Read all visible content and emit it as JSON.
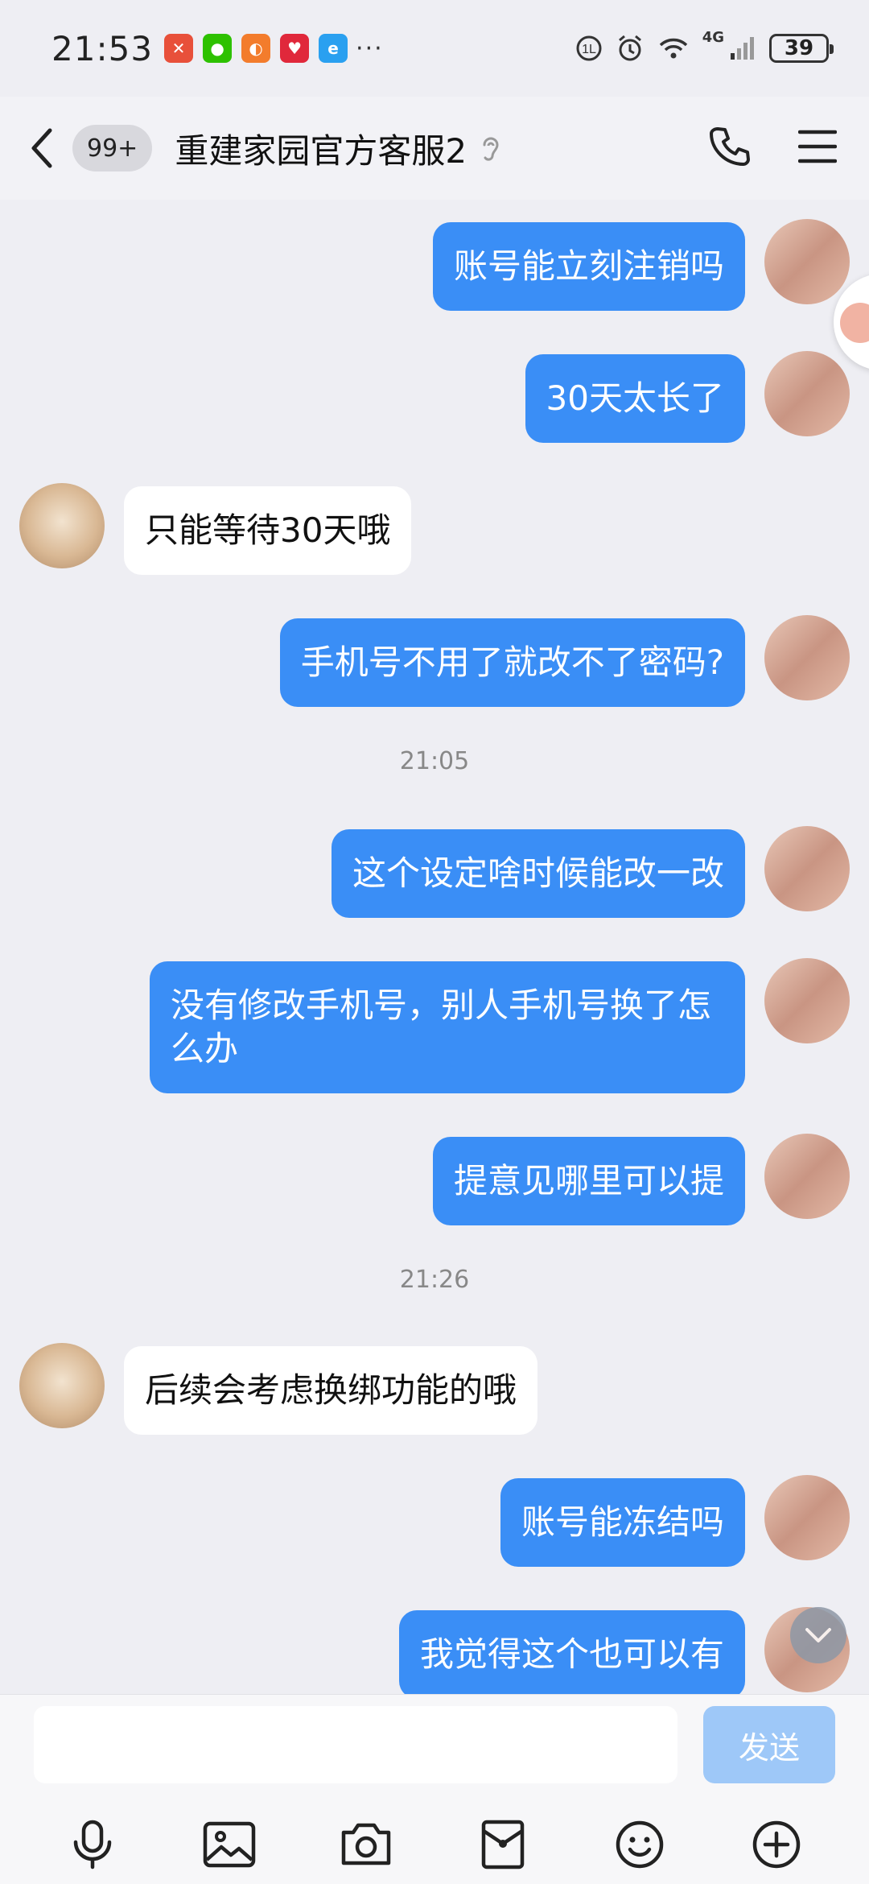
{
  "status_bar": {
    "time": "21:53",
    "network": "4G",
    "battery": "39"
  },
  "header": {
    "unread_badge": "99+",
    "title": "重建家园官方客服2"
  },
  "messages": [
    {
      "sender": "me",
      "text": "账号能立刻注销吗"
    },
    {
      "sender": "me",
      "text": "30天太长了"
    },
    {
      "sender": "bot",
      "text": "只能等待30天哦"
    },
    {
      "sender": "me",
      "text": "手机号不用了就改不了密码?"
    },
    {
      "type": "time",
      "text": "21:05"
    },
    {
      "sender": "me",
      "text": "这个设定啥时候能改一改"
    },
    {
      "sender": "me",
      "text": "没有修改手机号，别人手机号换了怎么办"
    },
    {
      "sender": "me",
      "text": "提意见哪里可以提"
    },
    {
      "type": "time",
      "text": "21:26"
    },
    {
      "sender": "bot",
      "text": "后续会考虑换绑功能的哦"
    },
    {
      "sender": "me",
      "text": "账号能冻结吗"
    },
    {
      "sender": "me",
      "text": "我觉得这个也可以有"
    }
  ],
  "composer": {
    "placeholder": "",
    "send_label": "发送"
  },
  "colors": {
    "my_bubble": "#3a8ef6",
    "bot_bubble": "#ffffff",
    "background": "#eeeef3",
    "send_disabled": "#9ec8f8"
  },
  "toolbar": {
    "items": [
      "microphone-icon",
      "image-icon",
      "camera-icon",
      "red-packet-icon",
      "emoji-icon",
      "plus-icon"
    ]
  }
}
